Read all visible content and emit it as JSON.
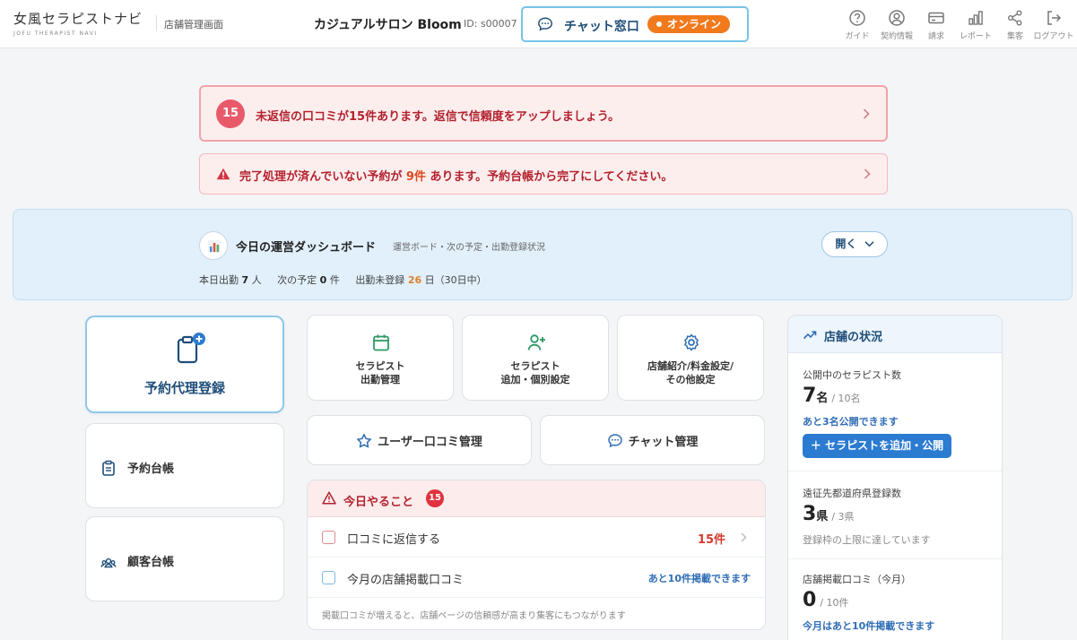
{
  "header": {
    "logo_main": "女風セラピストナビ",
    "logo_sub": "JOFU THERAPIST NAVI",
    "admin_label": "店舗管理画面",
    "shop_name": "カジュアルサロン Bloom",
    "shop_id": "ID: s00007",
    "chat_label": "チャット窓口",
    "chat_status": "オンライン",
    "nav": [
      {
        "label": "ガイド",
        "icon": "help-icon"
      },
      {
        "label": "契約情報",
        "icon": "user-circle-icon"
      },
      {
        "label": "請求",
        "icon": "credit-card-icon"
      },
      {
        "label": "レポート",
        "icon": "bar-chart-icon"
      },
      {
        "label": "集客",
        "icon": "share-icon"
      },
      {
        "label": "ログアウト",
        "icon": "logout-icon"
      }
    ]
  },
  "alerts": {
    "reviews_count": "15",
    "reviews_text": "未返信の口コミが15件あります。返信で信頼度をアップしましょう。",
    "reservation_prefix": "完了処理が済んでいない予約が",
    "reservation_count": "9件",
    "reservation_suffix": "あります。予約台帳から完了にしてください。"
  },
  "dashboard": {
    "title": "今日の運営ダッシュボード",
    "subtitle": "運営ボード・次の予定・出勤登録状況",
    "open_label": "開く",
    "stat1_label": "本日出勤",
    "stat1_value": "7",
    "stat1_unit": "人",
    "stat2_label": "次の予定",
    "stat2_value": "0",
    "stat2_unit": "件",
    "stat3_label": "出勤未登録",
    "stat3_value": "26",
    "stat3_unit": "日（30日中）"
  },
  "left": {
    "proxy_booking": "予約代理登録",
    "booking_ledger": "予約台帳",
    "customer_ledger": "顧客台帳"
  },
  "tiles": {
    "attendance": "セラピスト\n出勤管理",
    "add_therapist": "セラピスト\n追加・個別設定",
    "shop_settings": "店舗紹介/料金設定/\nその他設定",
    "reviews": "ユーザー口コミ管理",
    "chat": "チャット管理"
  },
  "todo": {
    "title": "今日やること",
    "count": "15",
    "rows": [
      {
        "label": "口コミに返信する",
        "right": "15件"
      },
      {
        "label": "今月の店舗掲載口コミ",
        "right": "あと10件掲載できます"
      }
    ],
    "footer": "掲載口コミが増えると、店舗ページの信頼感が高まり集客にもつながります"
  },
  "status": {
    "title": "店舗の状況",
    "sections": [
      {
        "title": "公開中のセラピスト数",
        "value": "7",
        "unit": "名",
        "total": "/ 10名",
        "note": "あと3名公開できます"
      },
      {
        "title": "遠征先都道府県登録数",
        "value": "3",
        "unit": "県",
        "total": "/ 3県",
        "note": "登録枠の上限に達しています"
      },
      {
        "title": "店舗掲載口コミ（今月）",
        "value": "0",
        "unit": "",
        "total": "/ 10件",
        "note": "今月はあと10件掲載できます"
      }
    ],
    "add_button": "＋ セラピストを追加・公開"
  },
  "colors": {
    "accent_blue": "#1f4e79",
    "alert_red": "#b3222e",
    "online_orange": "#f07a1c",
    "button_blue": "#2b7bd1"
  }
}
